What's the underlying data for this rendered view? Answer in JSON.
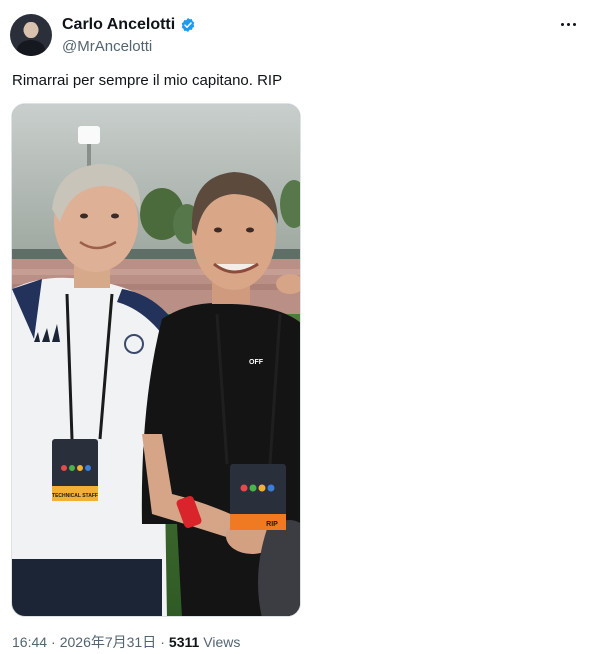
{
  "author": {
    "display_name": "Carlo Ancelotti",
    "handle": "@MrAncelotti",
    "verified_badge_color": "#1d9bf0",
    "avatar_icon": "profile-avatar",
    "more_icon": "more-horizontal-icon"
  },
  "tweet": {
    "text": "Rimarrai per sempre il mio capitano. RIP",
    "photo": {
      "shirt_text": "OFF",
      "badge_left_text": "TECHNICAL STAFF",
      "badge_right_text": "RIP"
    }
  },
  "meta": {
    "time": "16:44",
    "separator": "·",
    "date": "2026年7月31日",
    "separator2": "·",
    "views_count": "5311",
    "views_label": "Views"
  }
}
